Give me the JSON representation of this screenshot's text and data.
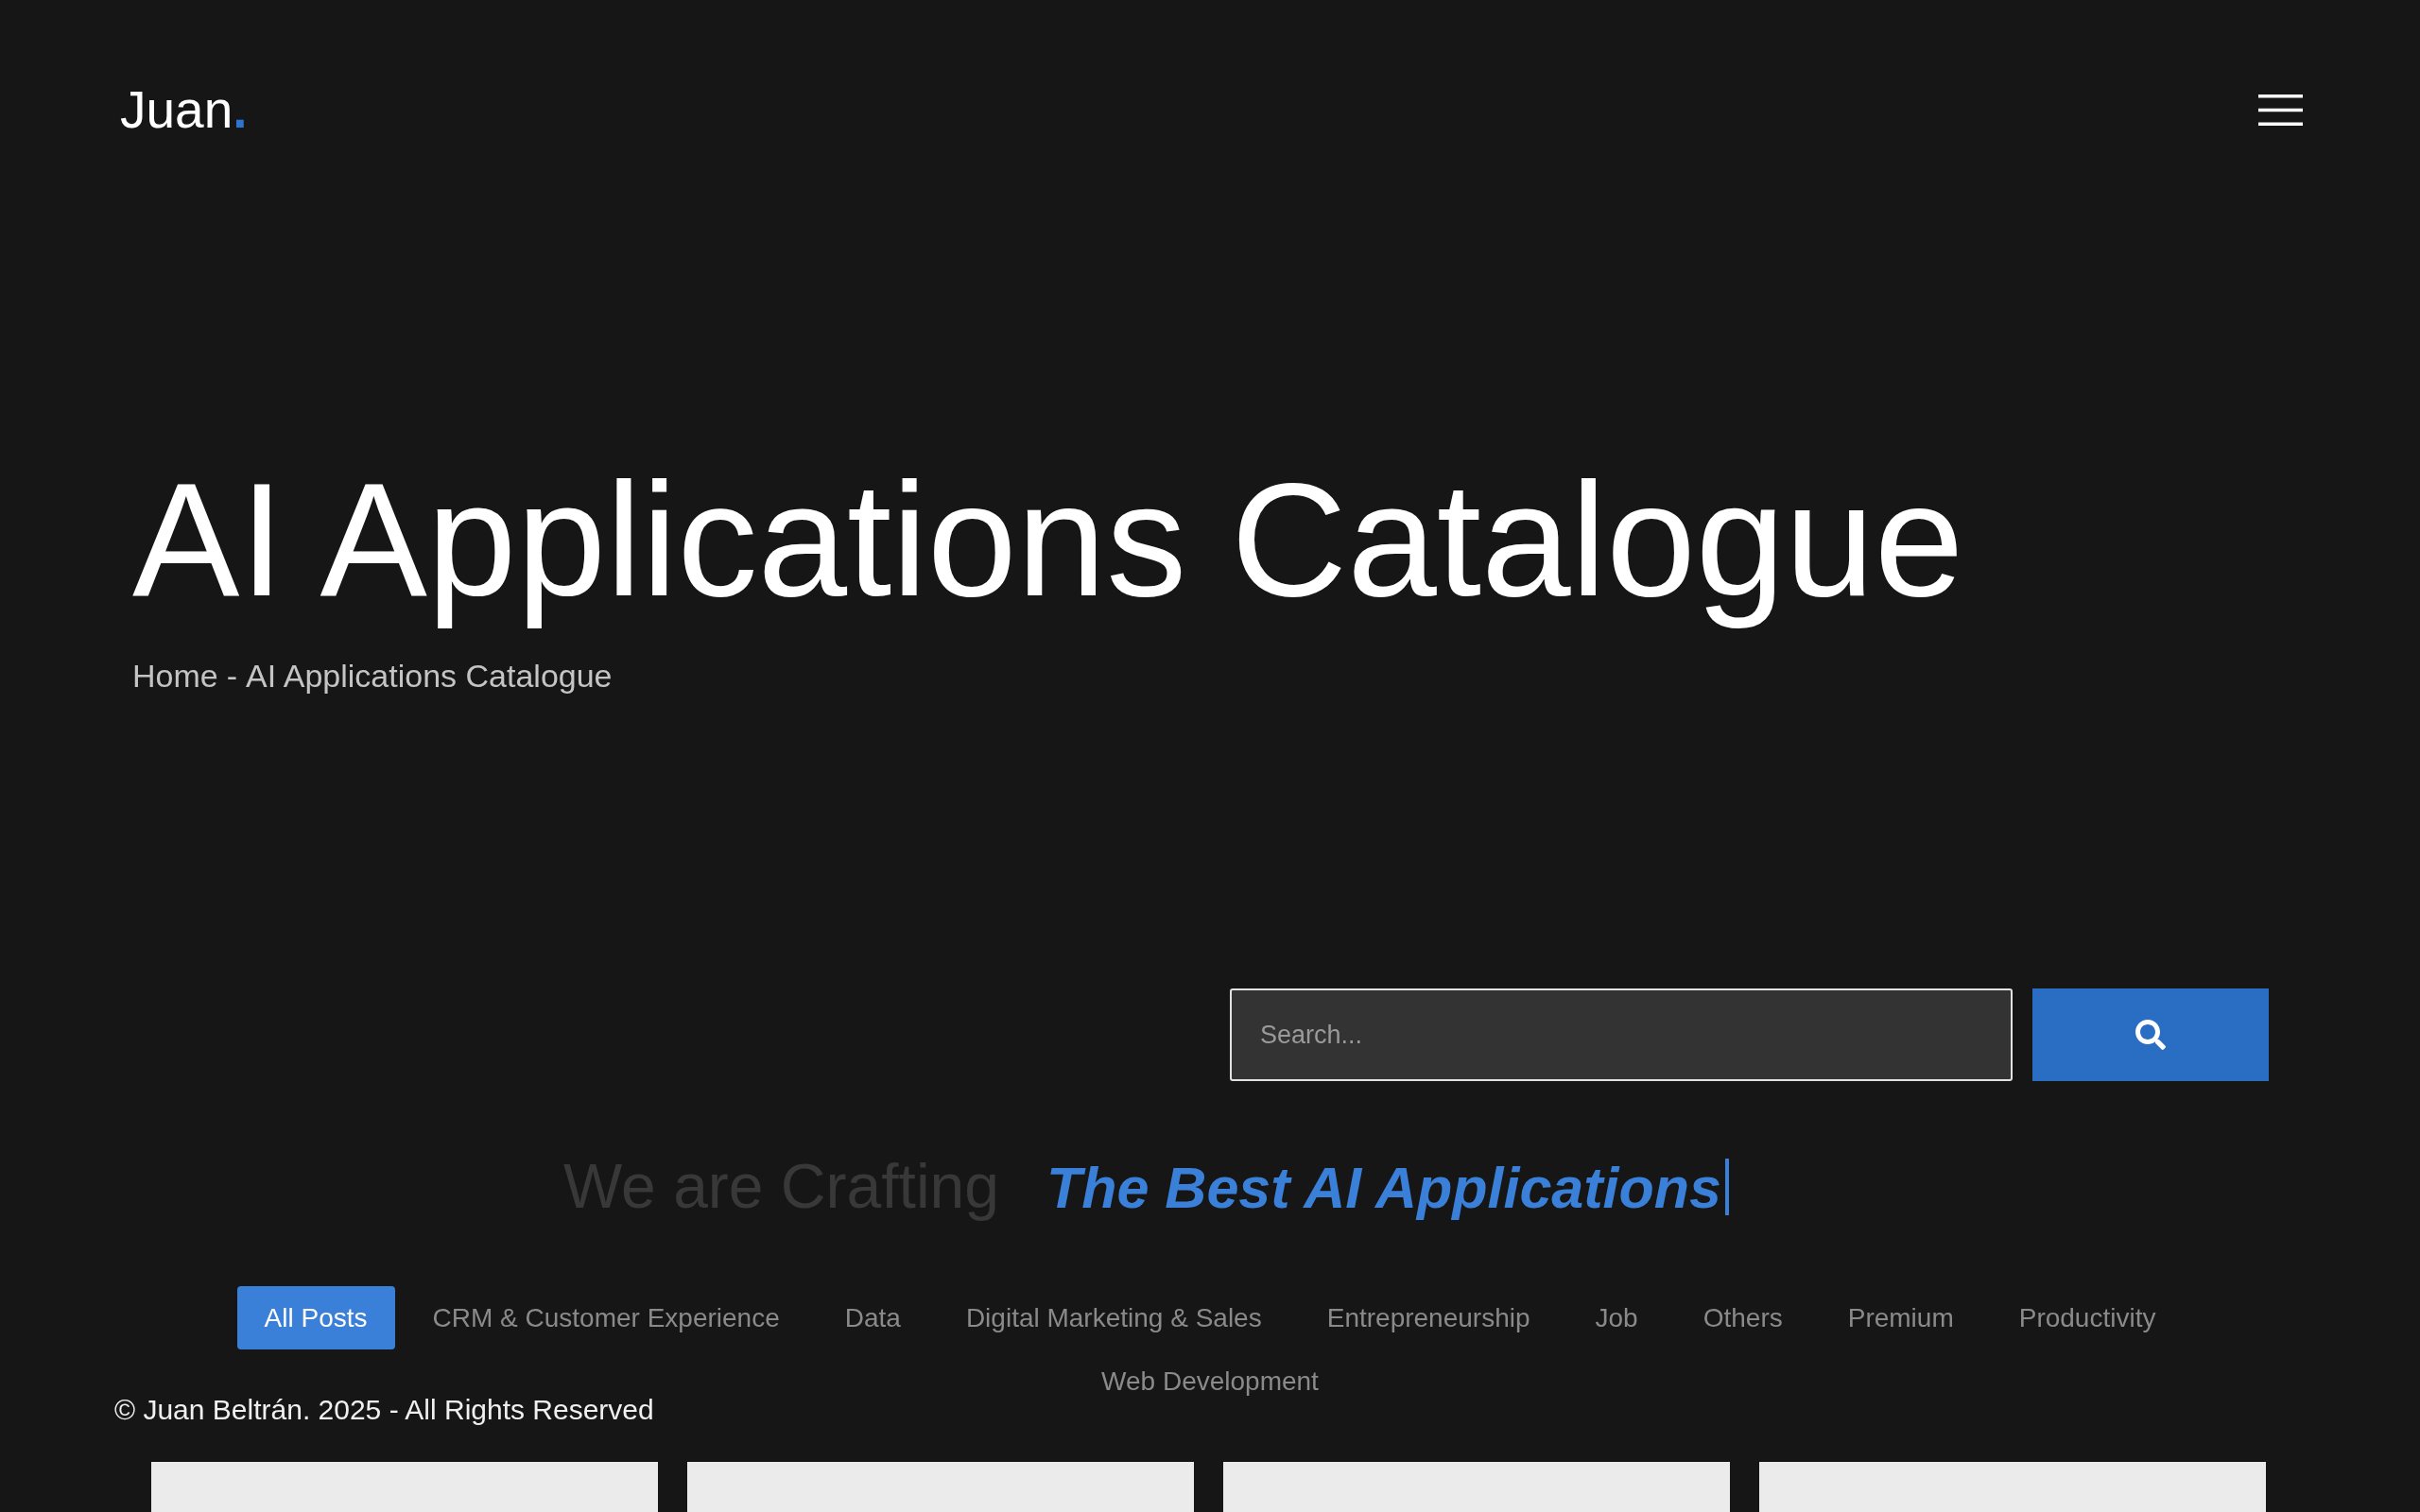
{
  "header": {
    "logo": {
      "text": "Juan",
      "accent": "."
    }
  },
  "hero": {
    "title": "AI Applications Catalogue",
    "breadcrumb": {
      "items": [
        "Home",
        "AI Applications Catalogue"
      ],
      "separator": "-"
    }
  },
  "search": {
    "placeholder": "Search..."
  },
  "tagline": {
    "static": "We are Crafting",
    "typed": "The Best AI Applications",
    "cursor": true
  },
  "filters": [
    {
      "label": "All Posts",
      "selected": true
    },
    {
      "label": "CRM & Customer Experience",
      "selected": false
    },
    {
      "label": "Data",
      "selected": false
    },
    {
      "label": "Digital Marketing & Sales",
      "selected": false
    },
    {
      "label": "Entrepreneurship",
      "selected": false
    },
    {
      "label": "Job",
      "selected": false
    },
    {
      "label": "Others",
      "selected": false
    },
    {
      "label": "Premium",
      "selected": false
    },
    {
      "label": "Productivity",
      "selected": false
    },
    {
      "label": "Web Development",
      "selected": false
    }
  ],
  "footer": {
    "copyright": "© Juan Beltrán. 2025 - All Rights Reserved"
  },
  "posts": [
    {
      "kind": "cover"
    },
    {
      "kind": "cover"
    },
    {
      "kind": "cover"
    },
    {
      "kind": "cover"
    }
  ]
}
